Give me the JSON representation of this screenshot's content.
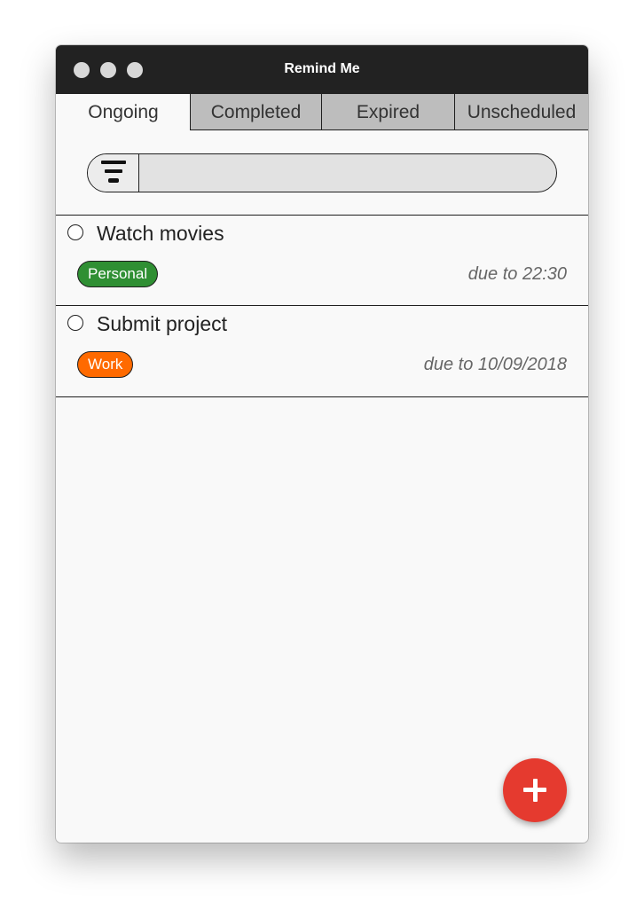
{
  "window": {
    "title": "Remind Me"
  },
  "tabs": [
    {
      "label": "Ongoing",
      "active": true
    },
    {
      "label": "Completed",
      "active": false
    },
    {
      "label": "Expired",
      "active": false
    },
    {
      "label": "Unscheduled",
      "active": false
    }
  ],
  "search": {
    "value": "",
    "placeholder": ""
  },
  "tasks": [
    {
      "title": "Watch movies",
      "category": "Personal",
      "category_color": "#2f8f33",
      "due": "due to 22:30",
      "done": false
    },
    {
      "title": "Submit project",
      "category": "Work",
      "category_color": "#ff6a00",
      "due": "due to 10/09/2018",
      "done": false
    }
  ],
  "icons": {
    "filter": "filter-icon",
    "add": "plus-icon",
    "window_controls": [
      "close-dot",
      "minimize-dot",
      "zoom-dot"
    ]
  },
  "colors": {
    "titlebar": "#222222",
    "fab": "#e53a2f",
    "tab_inactive": "#bdbdbd"
  }
}
